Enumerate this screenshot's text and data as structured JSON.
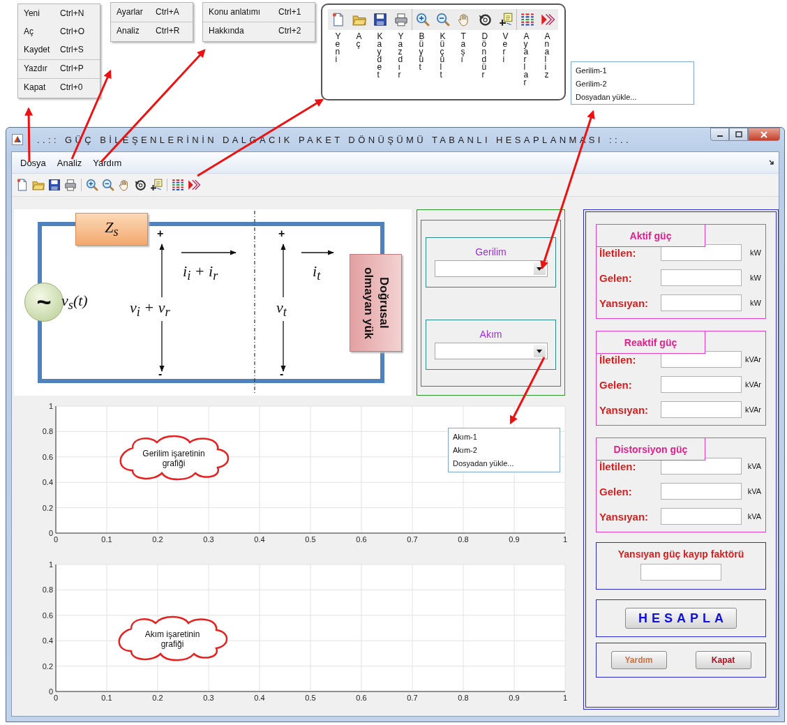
{
  "annotations": {
    "file_menu": [
      {
        "label": "Yeni",
        "shortcut": "Ctrl+N",
        "separator_before": false
      },
      {
        "label": "Aç",
        "shortcut": "Ctrl+O",
        "separator_before": false
      },
      {
        "label": "Kaydet",
        "shortcut": "Ctrl+S",
        "separator_before": false
      },
      {
        "label": "Yazdır",
        "shortcut": "Ctrl+P",
        "separator_before": true
      },
      {
        "label": "Kapat",
        "shortcut": "Ctrl+0",
        "separator_before": true
      }
    ],
    "analysis_menu": [
      {
        "label": "Ayarlar",
        "shortcut": "Ctrl+A",
        "separator_before": false
      },
      {
        "label": "Analiz",
        "shortcut": "Ctrl+R",
        "separator_before": true
      }
    ],
    "help_menu": [
      {
        "label": "Konu anlatımı",
        "shortcut": "Ctrl+1",
        "separator_before": false
      },
      {
        "label": "Hakkında",
        "shortcut": "Ctrl+2",
        "separator_before": true
      }
    ],
    "toolbar_legend": [
      {
        "kind": "new",
        "label": "Yeni",
        "separator_before": false
      },
      {
        "kind": "open",
        "label": "Aç",
        "separator_before": false
      },
      {
        "kind": "save",
        "label": "Kaydet",
        "separator_before": false
      },
      {
        "kind": "print",
        "label": "Yazdır",
        "separator_before": false
      },
      {
        "kind": "zoom_in",
        "label": "Büyüt",
        "separator_before": true
      },
      {
        "kind": "zoom_out",
        "label": "Küçült",
        "separator_before": false
      },
      {
        "kind": "pan",
        "label": "Taşı",
        "separator_before": false
      },
      {
        "kind": "rotate",
        "label": "Döndür",
        "separator_before": false
      },
      {
        "kind": "data",
        "label": "Veri",
        "separator_before": false
      },
      {
        "kind": "settings",
        "label": "Ayarlar",
        "separator_before": true
      },
      {
        "kind": "analyze",
        "label": "Analiz",
        "separator_before": false
      }
    ],
    "voltage_options": [
      "Gerilim-1",
      "Gerilim-2",
      "Dosyadan yükle..."
    ],
    "current_options": [
      "Akım-1",
      "Akım-2",
      "Dosyadan yükle..."
    ]
  },
  "window": {
    "title": "..:: GÜÇ BİLEŞENLERİNİN DALGACIK PAKET DÖNÜŞÜMÜ TABANLI HESAPLANMASI ::.."
  },
  "menu": [
    "Dosya",
    "Analiz",
    "Yardım"
  ],
  "toolbar": [
    {
      "kind": "new",
      "separator_before": false
    },
    {
      "kind": "open",
      "separator_before": false
    },
    {
      "kind": "save",
      "separator_before": false
    },
    {
      "kind": "print",
      "separator_before": false
    },
    {
      "kind": "zoom_in",
      "separator_before": true
    },
    {
      "kind": "zoom_out",
      "separator_before": false
    },
    {
      "kind": "pan",
      "separator_before": false
    },
    {
      "kind": "rotate",
      "separator_before": false
    },
    {
      "kind": "data",
      "separator_before": false
    },
    {
      "kind": "settings",
      "separator_before": true
    },
    {
      "kind": "analyze",
      "separator_before": false
    }
  ],
  "circuit": {
    "impedance": "Z$_{s}$",
    "source_symbol": "~",
    "source_label": "v$_{s}$(t)",
    "incident_current": "i$_{i}$ + i$_{r}$",
    "incident_voltage": "v$_{i}$ + v$_{r}$",
    "load_voltage": "v$_{t}$",
    "load_current": "i$_{t}$",
    "polarity_marks": [
      "+",
      "-",
      "+",
      "-"
    ],
    "load": "Doğrusal olmayan yük"
  },
  "selectors": [
    {
      "label": "Gerilim"
    },
    {
      "label": "Akım"
    }
  ],
  "plots": [
    {
      "note": "Gerilim işaretinin grafiği",
      "chart_data": {
        "type": "line",
        "grid": true,
        "xlim": [
          0,
          1
        ],
        "ylim": [
          0,
          1
        ],
        "xticks": [
          0,
          0.1,
          0.2,
          0.3,
          0.4,
          0.5,
          0.6,
          0.7,
          0.8,
          0.9,
          1
        ],
        "yticks": [
          0,
          0.2,
          0.4,
          0.6,
          0.8,
          1
        ]
      }
    },
    {
      "note": "Akım işaretinin grafiği",
      "chart_data": {
        "type": "line",
        "grid": true,
        "xlim": [
          0,
          1
        ],
        "ylim": [
          0,
          1
        ],
        "xticks": [
          0,
          0.1,
          0.2,
          0.3,
          0.4,
          0.5,
          0.6,
          0.7,
          0.8,
          0.9,
          1
        ],
        "yticks": [
          0,
          0.2,
          0.4,
          0.6,
          0.8,
          1
        ]
      }
    }
  ],
  "power_groups": [
    {
      "title": "Aktif güç",
      "rows": [
        {
          "label": "İletilen:",
          "unit": "kW"
        },
        {
          "label": "Gelen:",
          "unit": "kW"
        },
        {
          "label": "Yansıyan:",
          "unit": "kW"
        }
      ]
    },
    {
      "title": "Reaktif güç",
      "rows": [
        {
          "label": "İletilen:",
          "unit": "kVAr"
        },
        {
          "label": "Gelen:",
          "unit": "kVAr"
        },
        {
          "label": "Yansıyan:",
          "unit": "kVAr"
        }
      ]
    },
    {
      "title": "Distorsiyon güç",
      "rows": [
        {
          "label": "İletilen:",
          "unit": "kVA"
        },
        {
          "label": "Gelen:",
          "unit": "kVA"
        },
        {
          "label": "Yansıyan:",
          "unit": "kVA"
        }
      ]
    }
  ],
  "loss_factor": {
    "label": "Yansıyan güç kayıp faktörü"
  },
  "calculate_button": "HESAPLA",
  "buttons": [
    {
      "kind": "help",
      "label": "Yardım"
    },
    {
      "kind": "close",
      "label": "Kapat"
    }
  ]
}
